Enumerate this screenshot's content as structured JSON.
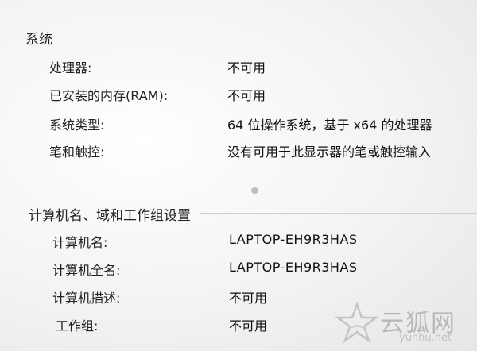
{
  "system": {
    "title": "系统",
    "rows": [
      {
        "label": "处理器:",
        "value": "不可用"
      },
      {
        "label": "已安装的内存(RAM):",
        "value": "不可用"
      },
      {
        "label": "系统类型:",
        "value": "64 位操作系统，基于 x64 的处理器"
      },
      {
        "label": "笔和触控:",
        "value": "没有可用于此显示器的笔或触控输入"
      }
    ]
  },
  "computer": {
    "title": "计算机名、域和工作组设置",
    "rows": [
      {
        "label": "计算机名:",
        "value": "LAPTOP-EH9R3HAS"
      },
      {
        "label": "计算机全名:",
        "value": "LAPTOP-EH9R3HAS"
      },
      {
        "label": "计算机描述:",
        "value": "不可用"
      },
      {
        "label": "工作组:",
        "value": "不可用"
      }
    ]
  },
  "watermark": {
    "text": "云狐网",
    "sub": "yunhu.net",
    "icon": "fox-star-logo-icon"
  }
}
